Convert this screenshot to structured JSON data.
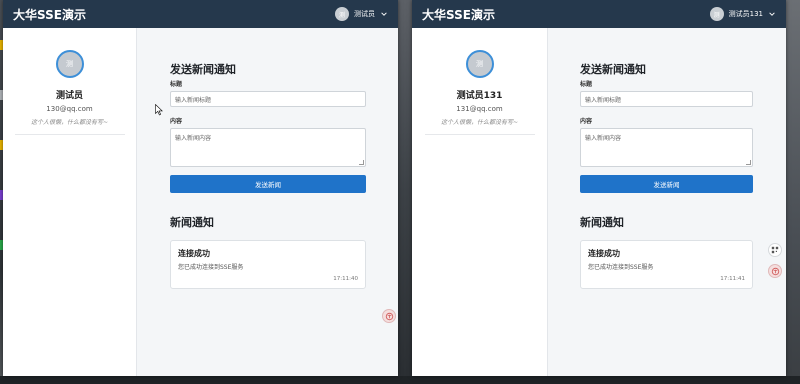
{
  "app": {
    "brand": "大华SSE演示"
  },
  "windows": [
    {
      "user": {
        "avatar_text": "测",
        "menu_name": "测试员",
        "name": "测试员",
        "email": "130@qq.com",
        "signature": "这个人很懒，什么都没有写~"
      },
      "form": {
        "heading": "发送新闻通知",
        "title_label": "标题",
        "title_placeholder": "输入新闻标题",
        "content_label": "内容",
        "content_placeholder": "输入新闻内容",
        "send_label": "发送新闻"
      },
      "news": {
        "heading": "新闻通知",
        "items": [
          {
            "title": "连接成功",
            "message": "您已成功连接到SSE服务",
            "time": "17:11:40"
          }
        ]
      }
    },
    {
      "user": {
        "avatar_text": "测",
        "menu_name": "测试员131",
        "name": "测试员131",
        "email": "131@qq.com",
        "signature": "这个人很懒，什么都没有写~"
      },
      "form": {
        "heading": "发送新闻通知",
        "title_label": "标题",
        "title_placeholder": "输入新闻标题",
        "content_label": "内容",
        "content_placeholder": "输入新闻内容",
        "send_label": "发送新闻"
      },
      "news": {
        "heading": "新闻通知",
        "items": [
          {
            "title": "连接成功",
            "message": "您已成功连接到SSE服务",
            "time": "17:11:41"
          }
        ]
      }
    }
  ],
  "colors": {
    "topbar": "#25384c",
    "primary_button": "#1f73c9",
    "avatar_ring": "#3d8fd8"
  },
  "icons": [
    "chevron-down-icon",
    "translate-icon",
    "qr-code-icon",
    "mouse-cursor-icon"
  ]
}
